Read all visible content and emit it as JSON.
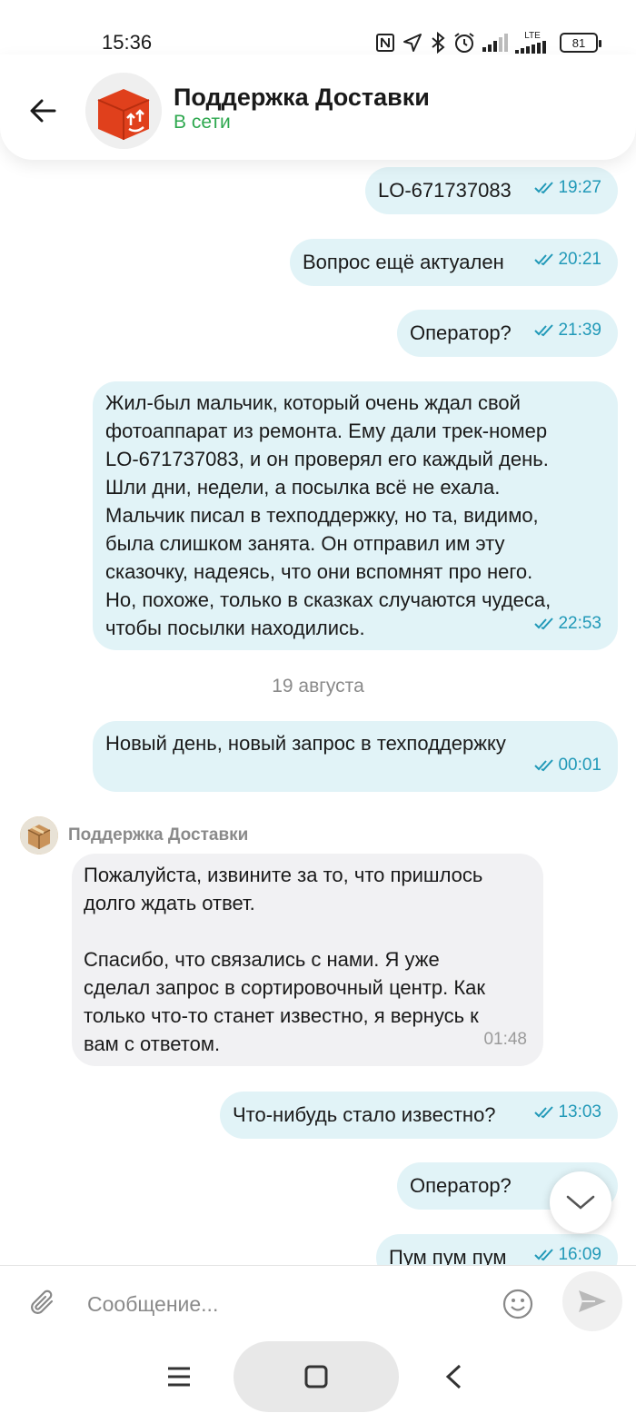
{
  "status_bar": {
    "time": "15:36",
    "lte_label": "LTE",
    "battery": "81",
    "icons": [
      "nfc-icon",
      "location-icon",
      "bluetooth-icon",
      "alarm-icon",
      "signal-icon",
      "lte-signal-icon",
      "battery-icon"
    ]
  },
  "header": {
    "title": "Поддержка Доставки",
    "status": "В сети",
    "status_color": "#2ea84f",
    "avatar_color": "#e0401c"
  },
  "messages": [
    {
      "direction": "out",
      "text": "LO-671737083",
      "time": "19:27",
      "read": true
    },
    {
      "direction": "out",
      "text": "Вопрос ещё актуален",
      "time": "20:21",
      "read": true
    },
    {
      "direction": "out",
      "text": "Оператор?",
      "time": "21:39",
      "read": true
    },
    {
      "direction": "out",
      "text": "Жил-был мальчик, который очень ждал свой\nфотоаппарат из ремонта. Ему дали трек-номер\nLO-671737083, и он проверял его каждый день.\nШли дни, недели, а посылка всё не ехала.\nМальчик писал в техподдержку, но та, видимо,\nбыла слишком занята. Он отправил им эту\nсказочку, надеясь, что они вспомнят про него.\nНо, похоже, только в сказках случаются чудеса,\nчтобы посылки находились.",
      "time": "22:53",
      "read": true
    },
    {
      "direction": "out",
      "text": "Новый день, новый запрос в техподдержку",
      "time": "00:01",
      "read": true
    },
    {
      "direction": "in",
      "sender": "Поддержка Доставки",
      "text": "Пожалуйста, извините за то, что пришлось\nдолго ждать ответ.\n\nСпасибо, что связались с нами. Я уже\nсделал запрос в сортировочный центр. Как\nтолько что-то станет известно, я вернусь к\nвам с ответом.",
      "time": "01:48"
    },
    {
      "direction": "out",
      "text": "Что-нибудь стало известно?",
      "time": "13:03",
      "read": true
    },
    {
      "direction": "out",
      "text": "Оператор?",
      "time": "",
      "read": true
    },
    {
      "direction": "out",
      "text": "Пум пум пум",
      "time": "16:09",
      "read": true
    }
  ],
  "date_separator": "19 августа",
  "composer": {
    "placeholder": "Сообщение..."
  },
  "colors": {
    "outgoing_bubble": "#e1f3f7",
    "incoming_bubble": "#f1f1f3",
    "time_accent": "#2199b8"
  }
}
